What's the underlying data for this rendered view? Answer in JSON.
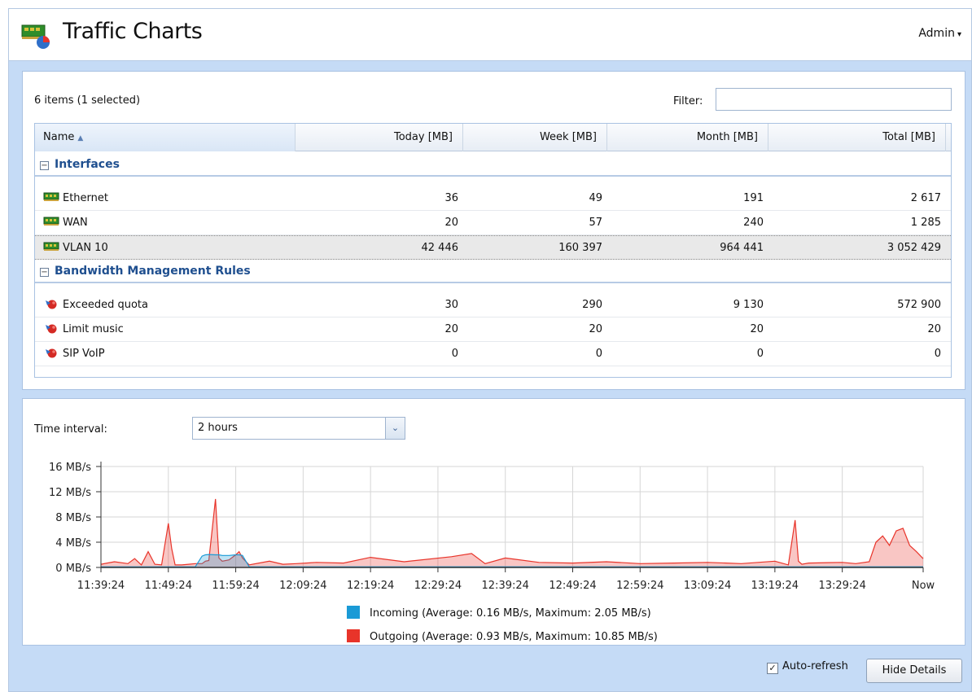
{
  "header": {
    "title": "Traffic Charts",
    "user_menu": "Admin",
    "caret": "▾"
  },
  "table_panel": {
    "items_count": "6 items (1 selected)",
    "filter_label": "Filter:",
    "filter_value": "",
    "columns": [
      "Name",
      "Today [MB]",
      "Week [MB]",
      "Month [MB]",
      "Total [MB]"
    ],
    "sort_indicator": "▲",
    "groups": [
      {
        "label": "Interfaces",
        "toggle": "−",
        "icon": "network-card-icon",
        "rows": [
          {
            "name": "Ethernet",
            "today": "36",
            "week": "49",
            "month": "191",
            "total": "2 617"
          },
          {
            "name": "WAN",
            "today": "20",
            "week": "57",
            "month": "240",
            "total": "1 285"
          },
          {
            "name": "VLAN 10",
            "today": "42 446",
            "week": "160 397",
            "month": "964 441",
            "total": "3 052 429",
            "selected": true
          }
        ]
      },
      {
        "label": "Bandwidth Management Rules",
        "toggle": "−",
        "icon": "bandwidth-rule-icon",
        "rows": [
          {
            "name": "Exceeded quota",
            "today": "30",
            "week": "290",
            "month": "9 130",
            "total": "572 900"
          },
          {
            "name": "Limit music",
            "today": "20",
            "week": "20",
            "month": "20",
            "total": "20"
          },
          {
            "name": "SIP VoIP",
            "today": "0",
            "week": "0",
            "month": "0",
            "total": "0"
          }
        ]
      }
    ]
  },
  "chart_panel": {
    "time_interval_label": "Time interval:",
    "time_interval_value": "2 hours",
    "dropdown_glyph": "⌄"
  },
  "chart_data": {
    "type": "area",
    "y_ticks": [
      "16 MB/s",
      "12 MB/s",
      "8 MB/s",
      "4 MB/s",
      "0 MB/s"
    ],
    "ylim": [
      0,
      16
    ],
    "x_ticks": [
      "11:39:24",
      "11:49:24",
      "11:59:24",
      "12:09:24",
      "12:19:24",
      "12:29:24",
      "12:39:24",
      "12:49:24",
      "12:59:24",
      "13:09:24",
      "13:19:24",
      "13:29:24",
      "Now"
    ],
    "grid": true,
    "legend_position": "bottom",
    "x_minutes": [
      0,
      2,
      4,
      5,
      6,
      7,
      8,
      9,
      10,
      10.5,
      11,
      12,
      13,
      14,
      15,
      15.5,
      16,
      17,
      17.5,
      18,
      19,
      20,
      20.5,
      21,
      22,
      25,
      27,
      29,
      32,
      36,
      40,
      45,
      52,
      55,
      57,
      60,
      65,
      70,
      75,
      80,
      85,
      90,
      95,
      100,
      102,
      103,
      103.5,
      104,
      105,
      110,
      112,
      114,
      115,
      116,
      117,
      118,
      119,
      120,
      121,
      122
    ],
    "series": [
      {
        "name": "Incoming (Average: 0.16 MB/s, Maximum: 2.05 MB/s)",
        "color": "#1a9ad6",
        "values": [
          0.1,
          0.1,
          0.1,
          0.1,
          0.1,
          0.1,
          0.1,
          0.1,
          0.1,
          0.1,
          0.1,
          0.1,
          0.1,
          0.1,
          1.8,
          2.0,
          2.05,
          2.0,
          2.0,
          1.9,
          1.9,
          2.0,
          2.0,
          1.9,
          0.1,
          0.1,
          0.1,
          0.1,
          0.1,
          0.1,
          0.1,
          0.1,
          0.1,
          0.1,
          0.1,
          0.1,
          0.1,
          0.1,
          0.1,
          0.1,
          0.1,
          0.1,
          0.1,
          0.1,
          0.1,
          0.1,
          0.1,
          0.1,
          0.1,
          0.1,
          0.1,
          0.1,
          0.1,
          0.1,
          0.1,
          0.1,
          0.1,
          0.1,
          0.1,
          0.1
        ]
      },
      {
        "name": "Outgoing (Average: 0.93 MB/s, Maximum: 10.85 MB/s)",
        "color": "#e8342a",
        "values": [
          0.5,
          0.9,
          0.6,
          1.4,
          0.4,
          2.5,
          0.5,
          0.4,
          7.0,
          3.0,
          0.4,
          0.4,
          0.5,
          0.6,
          0.6,
          1.0,
          1.1,
          10.85,
          1.5,
          1.0,
          1.2,
          2.0,
          2.5,
          1.5,
          0.4,
          1.0,
          0.5,
          0.6,
          0.8,
          0.7,
          1.6,
          0.9,
          1.7,
          2.2,
          0.6,
          1.5,
          0.8,
          0.7,
          0.9,
          0.6,
          0.7,
          0.8,
          0.6,
          1.0,
          0.4,
          7.5,
          1.0,
          0.5,
          0.7,
          0.8,
          0.6,
          0.9,
          4.0,
          5.0,
          3.5,
          5.8,
          6.2,
          3.5,
          2.5,
          1.4
        ]
      }
    ]
  },
  "footer": {
    "auto_refresh_label": "Auto-refresh",
    "auto_refresh_checked": true,
    "check_glyph": "✓",
    "hide_details_label": "Hide Details"
  }
}
